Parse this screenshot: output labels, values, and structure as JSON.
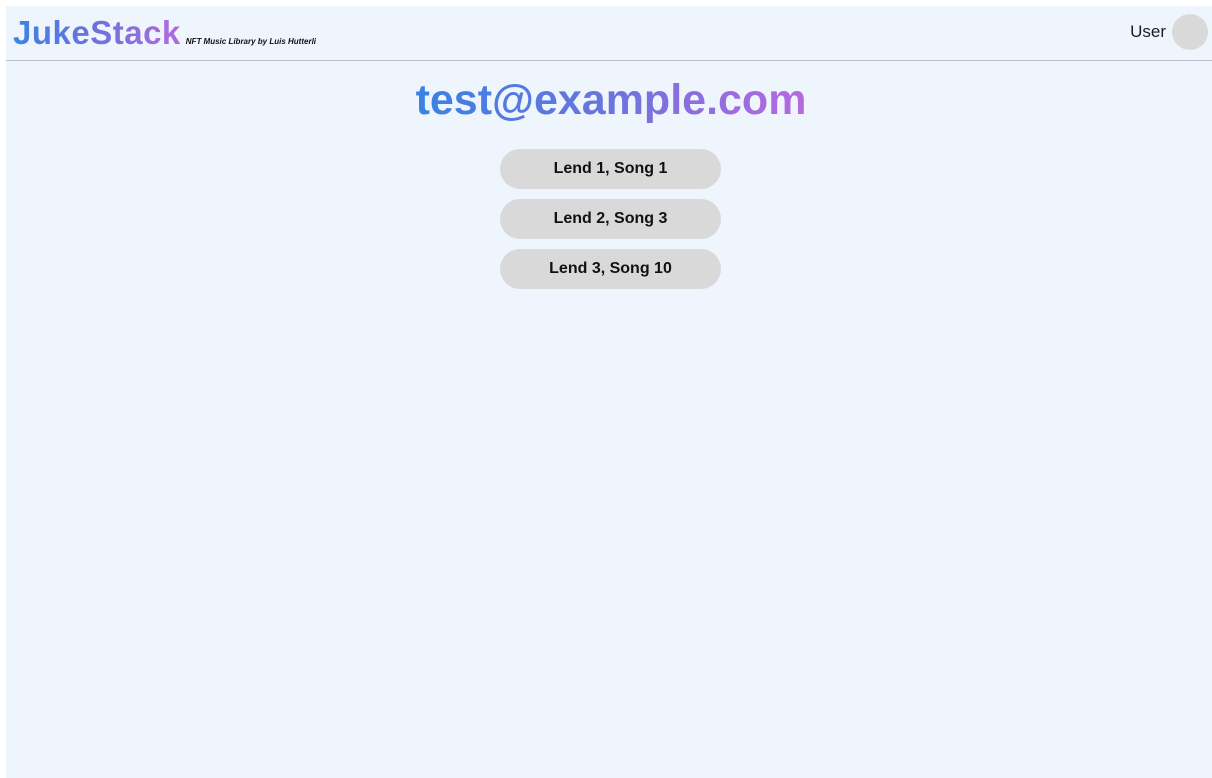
{
  "header": {
    "logo": "JukeStack",
    "tagline": "NFT Music Library by Luis Hutterli",
    "user_label": "User"
  },
  "main": {
    "title": "test@example.com",
    "lends": [
      {
        "label": "Lend 1, Song 1"
      },
      {
        "label": "Lend 2, Song 3"
      },
      {
        "label": "Lend 3, Song 10"
      }
    ]
  },
  "colors": {
    "background": "#eef5fd",
    "gradient_start": "#3a82e4",
    "gradient_end": "#b769df",
    "pill": "#d9d9d9"
  }
}
